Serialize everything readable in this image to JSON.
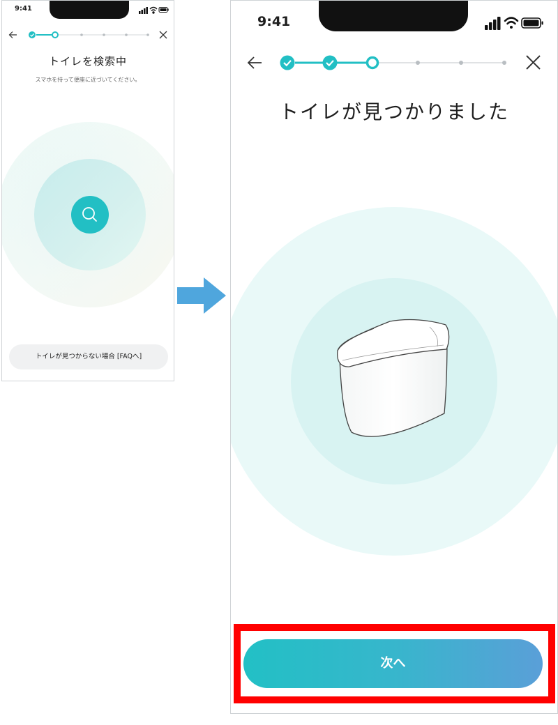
{
  "colors": {
    "accent": "#22bfc4",
    "accent_end": "#5a9fd8",
    "highlight": "#ff0000",
    "arrow": "#4fa6dd",
    "circle_outer": "#e9f9f8",
    "circle_inner": "#d8f3f2"
  },
  "screen_before": {
    "status_time": "9:41",
    "title": "トイレを検索中",
    "subtitle": "スマホを持って便座に近づいてください。",
    "faq_button": "トイレが見つからない場合 [FAQへ]",
    "icons": [
      "back-arrow-icon",
      "close-icon",
      "search-icon"
    ],
    "stepper": {
      "total_steps": 6,
      "completed": 1,
      "current": 2
    }
  },
  "transition_arrow_icon": "right-arrow-icon",
  "screen_after": {
    "status_time": "9:41",
    "title": "トイレが見つかりました",
    "next_button": "次へ",
    "icons": [
      "back-arrow-icon",
      "close-icon",
      "toilet-icon"
    ],
    "stepper": {
      "total_steps": 6,
      "completed": 2,
      "current": 3
    }
  }
}
